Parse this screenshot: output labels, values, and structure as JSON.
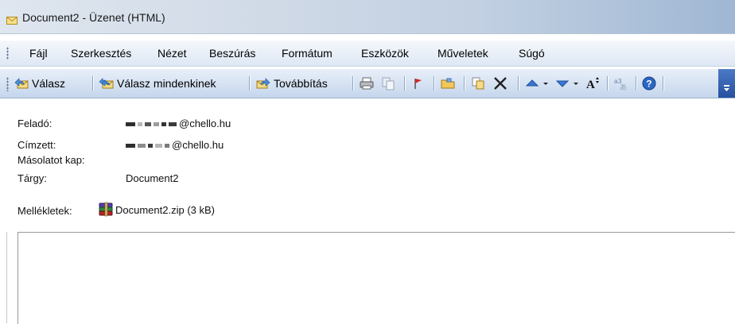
{
  "window": {
    "title": "Document2 - Üzenet (HTML)",
    "icon": "envelope-icon"
  },
  "menu": [
    {
      "label": "Fájl"
    },
    {
      "label": "Szerkesztés"
    },
    {
      "label": "Nézet"
    },
    {
      "label": "Beszúrás"
    },
    {
      "label": "Formátum"
    },
    {
      "label": "Eszközök"
    },
    {
      "label": "Műveletek"
    },
    {
      "label": "Súgó"
    }
  ],
  "toolbar": {
    "reply_label": "Válasz",
    "reply_all_label": "Válasz mindenkinek",
    "forward_label": "Továbbítás"
  },
  "header": {
    "from_label": "Feladó:",
    "from_value": "@chello.hu",
    "to_label": "Címzett:",
    "to_value": "@chello.hu",
    "cc_label": "Másolatot kap:",
    "subject_label": "Tárgy:",
    "subject_value": "Document2",
    "attachments_label": "Mellékletek:",
    "attachment_name": "Document2.zip (3 kB)"
  },
  "colors": {
    "toolbar_bg": "#c5d6ec",
    "menubar_bg": "#dde7f4",
    "accent_blue": "#24509e"
  }
}
